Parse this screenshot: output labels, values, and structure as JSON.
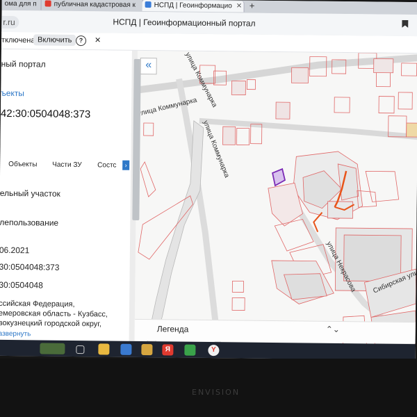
{
  "browser": {
    "tabs": [
      {
        "label": "ома для п",
        "active": false
      },
      {
        "label": "публичная кадастровая к",
        "active": false
      },
      {
        "label": "НСПД | Геоинформацио",
        "active": true
      }
    ],
    "new_tab": "+",
    "url_fragment": "r.ru",
    "page_title": "НСПД | Геоинформационный портал",
    "bookmark_icon": "bookmark-icon"
  },
  "notification": {
    "text": "тключена",
    "enable_label": "Включить",
    "help_label": "?",
    "close_label": "✕"
  },
  "panel": {
    "portal_label": "ный портал",
    "objects_link": "ъекты",
    "cadastral_number": "42:30:0504048:373",
    "tabs": [
      "Объекты",
      "Части ЗУ",
      "Состс"
    ],
    "tab_more": "›",
    "fields": [
      "ельный участок",
      "лепользование",
      "06.2021",
      "30:0504048:373",
      "30:0504048",
      "ссийская Федерация,",
      "емеровская область - Кузбасс,",
      "вокузнецкий городской округ,",
      "азвернуть"
    ],
    "collapse_label": "«"
  },
  "map": {
    "streets": [
      {
        "name": "улица Коммунарка"
      },
      {
        "name": "улица Коммунарка"
      },
      {
        "name": "улица Коммунарка"
      },
      {
        "name": "улица Некрасова"
      },
      {
        "name": "Сибирская ули"
      }
    ],
    "colors": {
      "parcel_stroke": "#e06666",
      "building_fill": "#e3e3e3",
      "selected_parcel": "#7b2bb5",
      "highlight": "#e8541a"
    }
  },
  "legend": {
    "title": "Легенда",
    "chevron": "⌃⌄"
  },
  "taskbar": {
    "icons": [
      "task-view-icon",
      "file-explorer-icon",
      "mail-icon",
      "folder-icon",
      "yandex-icon",
      "messenger-icon",
      "yandex-browser-icon"
    ]
  },
  "monitor": {
    "brand": "ENVISION"
  }
}
